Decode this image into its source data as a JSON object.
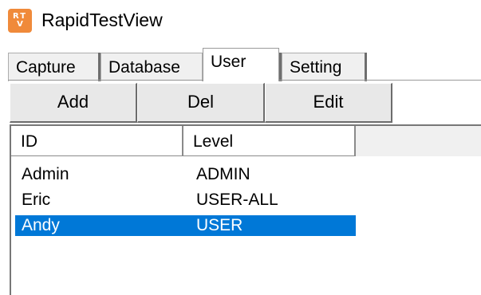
{
  "window": {
    "icon_text_top": "RT",
    "icon_text_bottom": "V",
    "title": "RapidTestView"
  },
  "tabs": [
    {
      "label": "Capture",
      "active": false
    },
    {
      "label": "Database",
      "active": false
    },
    {
      "label": "User",
      "active": true
    },
    {
      "label": "Setting",
      "active": false
    }
  ],
  "toolbar": {
    "add_label": "Add",
    "del_label": "Del",
    "edit_label": "Edit"
  },
  "list": {
    "columns": [
      "ID",
      "Level"
    ],
    "rows": [
      {
        "id": "Admin",
        "level": "ADMIN",
        "selected": false
      },
      {
        "id": "Eric",
        "level": "USER-ALL",
        "selected": false
      },
      {
        "id": "Andy",
        "level": "USER",
        "selected": true
      }
    ]
  },
  "colors": {
    "selection": "#0078d7",
    "app_icon": "#f08a3a"
  }
}
